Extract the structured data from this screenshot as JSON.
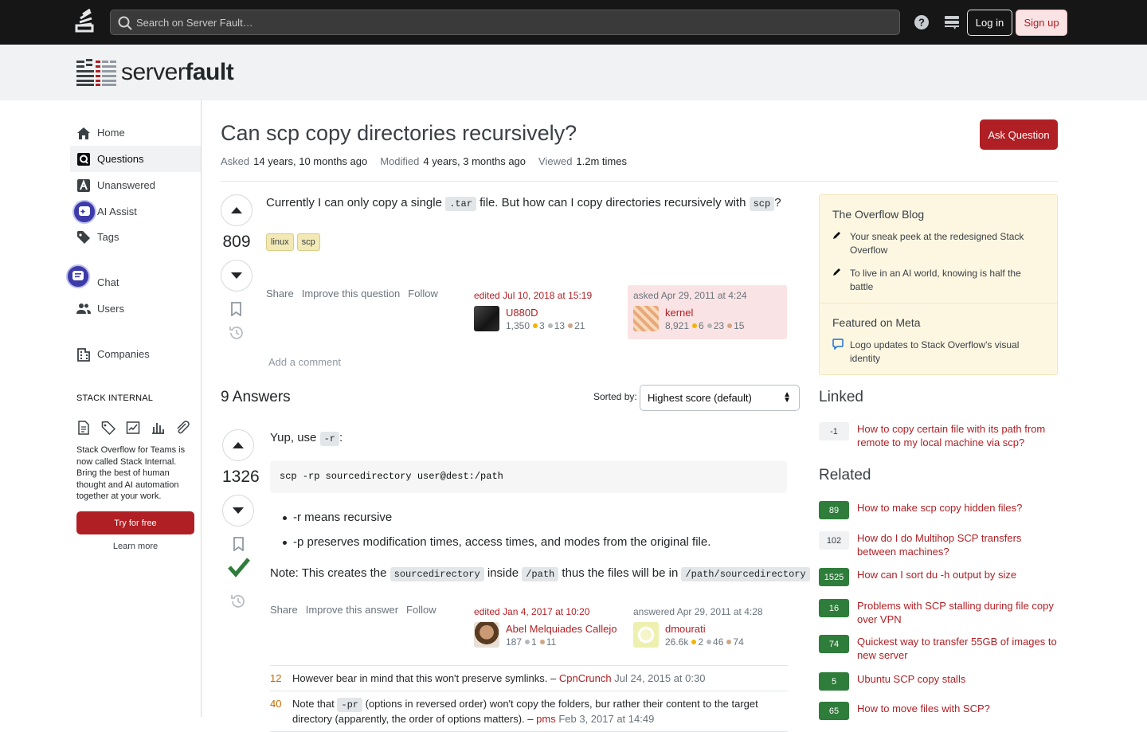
{
  "topbar": {
    "search_placeholder": "Search on Server Fault…",
    "login": "Log in",
    "signup": "Sign up"
  },
  "site": {
    "brand_light": "server",
    "brand_bold": "fault"
  },
  "nav": {
    "home": "Home",
    "questions": "Questions",
    "unanswered": "Unanswered",
    "ai_assist": "AI Assist",
    "tags": "Tags",
    "chat": "Chat",
    "users": "Users",
    "companies": "Companies"
  },
  "stack_internal": {
    "heading": "STACK INTERNAL",
    "text": "Stack Overflow for Teams is now called Stack Internal. Bring the best of human thought and AI automation together at your work.",
    "try": "Try for free",
    "learn": "Learn more"
  },
  "question": {
    "title": "Can scp copy directories recursively?",
    "ask_button": "Ask Question",
    "asked_label": "Asked",
    "asked": "14 years, 10 months ago",
    "modified_label": "Modified",
    "modified": "4 years, 3 months ago",
    "viewed_label": "Viewed",
    "viewed": "1.2m times",
    "score": "809",
    "body_1": "Currently I can only copy a single",
    "code_1": ".tar",
    "body_2": "file. But how can I copy directories recursively with",
    "code_2": "scp",
    "body_3": "?",
    "tags": [
      "linux",
      "scp"
    ],
    "menu": {
      "share": "Share",
      "improve": "Improve this question",
      "follow": "Follow"
    },
    "edited": {
      "when": "edited Jul 10, 2018 at 15:19",
      "name": "U880D",
      "rep": "1,350",
      "gold": "3",
      "silver": "13",
      "bronze": "21"
    },
    "asked_by": {
      "when": "asked Apr 29, 2011 at 4:24",
      "name": "kernel",
      "rep": "8,921",
      "gold": "6",
      "silver": "23",
      "bronze": "15"
    },
    "add_comment": "Add a comment"
  },
  "answers": {
    "count": "9 Answers",
    "sorted_label": "Sorted by:",
    "sort_value": "Highest score (default)"
  },
  "answer": {
    "score": "1326",
    "intro_1": "Yup, use",
    "intro_code": "-r",
    "intro_2": ":",
    "code": "scp -rp sourcedirectory user@dest:/path",
    "bullets": [
      "-r means recursive",
      "-p preserves modification times, access times, and modes from the original file."
    ],
    "note_1": "Note: This creates the",
    "note_code_1": "sourcedirectory",
    "note_2": "inside",
    "note_code_2": "/path",
    "note_3": "thus the files will be in",
    "note_code_3": "/path/sourcedirectory",
    "menu": {
      "share": "Share",
      "improve": "Improve this answer",
      "follow": "Follow"
    },
    "edited": {
      "when": "edited Jan 4, 2017 at 10:20",
      "name": "Abel Melquiades Callejo",
      "rep": "187",
      "silver": "1",
      "bronze": "11"
    },
    "answered": {
      "when": "answered Apr 29, 2011 at 4:28",
      "name": "dmourati",
      "rep": "26.6k",
      "gold": "2",
      "silver": "46",
      "bronze": "74"
    },
    "comments": [
      {
        "score": "12",
        "text": "However bear in mind that this won't preserve symlinks. –",
        "user": "CpnCrunch",
        "date": "Jul 24, 2015 at 0:30"
      },
      {
        "score": "40",
        "text_1": "Note that",
        "code": "-pr",
        "text_2": "(options in reversed order) won't copy the folders, bur rather their content to the target directory (apparently, the order of options matters). –",
        "user": "pms",
        "date": "Feb 3, 2017 at 14:49"
      }
    ]
  },
  "sidebar": {
    "blog_heading": "The Overflow Blog",
    "blog_items": [
      "Your sneak peek at the redesigned Stack Overflow",
      "To live in an AI world, knowing is half the battle"
    ],
    "meta_heading": "Featured on Meta",
    "meta_items": [
      "Logo updates to Stack Overflow's visual identity"
    ],
    "linked_heading": "Linked",
    "linked": [
      {
        "score": "-1",
        "title": "How to copy certain file with its path from remote to my local machine via scp?"
      }
    ],
    "related_heading": "Related",
    "related": [
      {
        "score": "89",
        "title": "How to make scp copy hidden files?"
      },
      {
        "score": "102",
        "title": "How do I do Multihop SCP transfers between machines?"
      },
      {
        "score": "1525",
        "title": "How can I sort du -h output by size"
      },
      {
        "score": "16",
        "title": "Problems with SCP stalling during file copy over VPN"
      },
      {
        "score": "74",
        "title": "Quickest way to transfer 55GB of images to new server"
      },
      {
        "score": "5",
        "title": "Ubuntu SCP copy stalls"
      },
      {
        "score": "65",
        "title": "How to move files with SCP?"
      }
    ]
  }
}
